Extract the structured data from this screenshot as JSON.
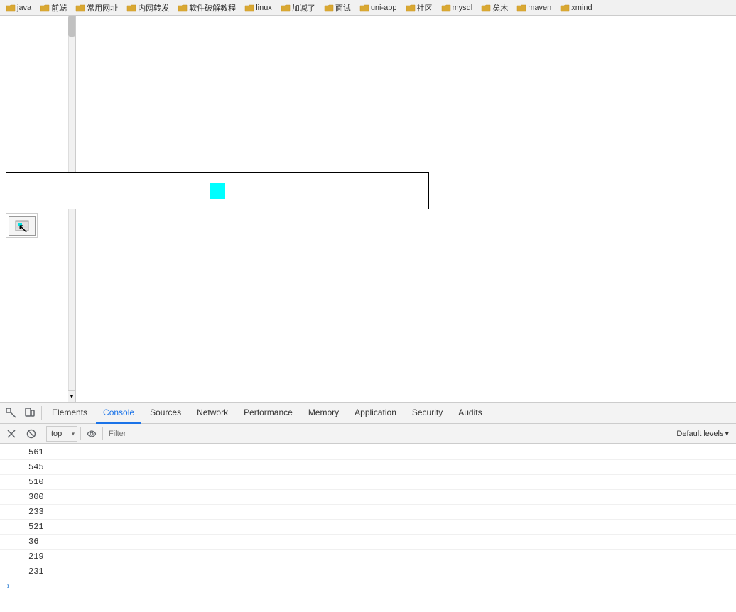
{
  "bookmarks": {
    "items": [
      {
        "label": "java",
        "color": "yellow"
      },
      {
        "label": "前端",
        "color": "yellow"
      },
      {
        "label": "常用网址",
        "color": "yellow"
      },
      {
        "label": "内网转发",
        "color": "yellow"
      },
      {
        "label": "软件破解教程",
        "color": "yellow"
      },
      {
        "label": "linux",
        "color": "yellow"
      },
      {
        "label": "加减了",
        "color": "yellow"
      },
      {
        "label": "面试",
        "color": "yellow"
      },
      {
        "label": "uni-app",
        "color": "yellow"
      },
      {
        "label": "社区",
        "color": "yellow"
      },
      {
        "label": "mysql",
        "color": "yellow"
      },
      {
        "label": "矣木",
        "color": "yellow"
      },
      {
        "label": "maven",
        "color": "yellow"
      },
      {
        "label": "xmind",
        "color": "yellow"
      }
    ]
  },
  "devtools": {
    "tabs": [
      {
        "label": "Elements",
        "active": false
      },
      {
        "label": "Console",
        "active": true
      },
      {
        "label": "Sources",
        "active": false
      },
      {
        "label": "Network",
        "active": false
      },
      {
        "label": "Performance",
        "active": false
      },
      {
        "label": "Memory",
        "active": false
      },
      {
        "label": "Application",
        "active": false
      },
      {
        "label": "Security",
        "active": false
      },
      {
        "label": "Audits",
        "active": false
      }
    ],
    "console": {
      "context_selector": "top",
      "filter_placeholder": "Filter",
      "levels_label": "Default levels",
      "output_lines": [
        "561",
        "545",
        "510",
        "300",
        "233",
        "521",
        "36",
        "219",
        "231"
      ]
    }
  },
  "canvas": {
    "cyan_color": "#00ffff"
  },
  "icons": {
    "inspect": "⬚",
    "device": "⬜",
    "no_entry": "🚫",
    "eye": "👁",
    "dropdown_arrow": "▾",
    "scroll_up": "▲",
    "scroll_down": "▼",
    "cursor": "↖"
  }
}
